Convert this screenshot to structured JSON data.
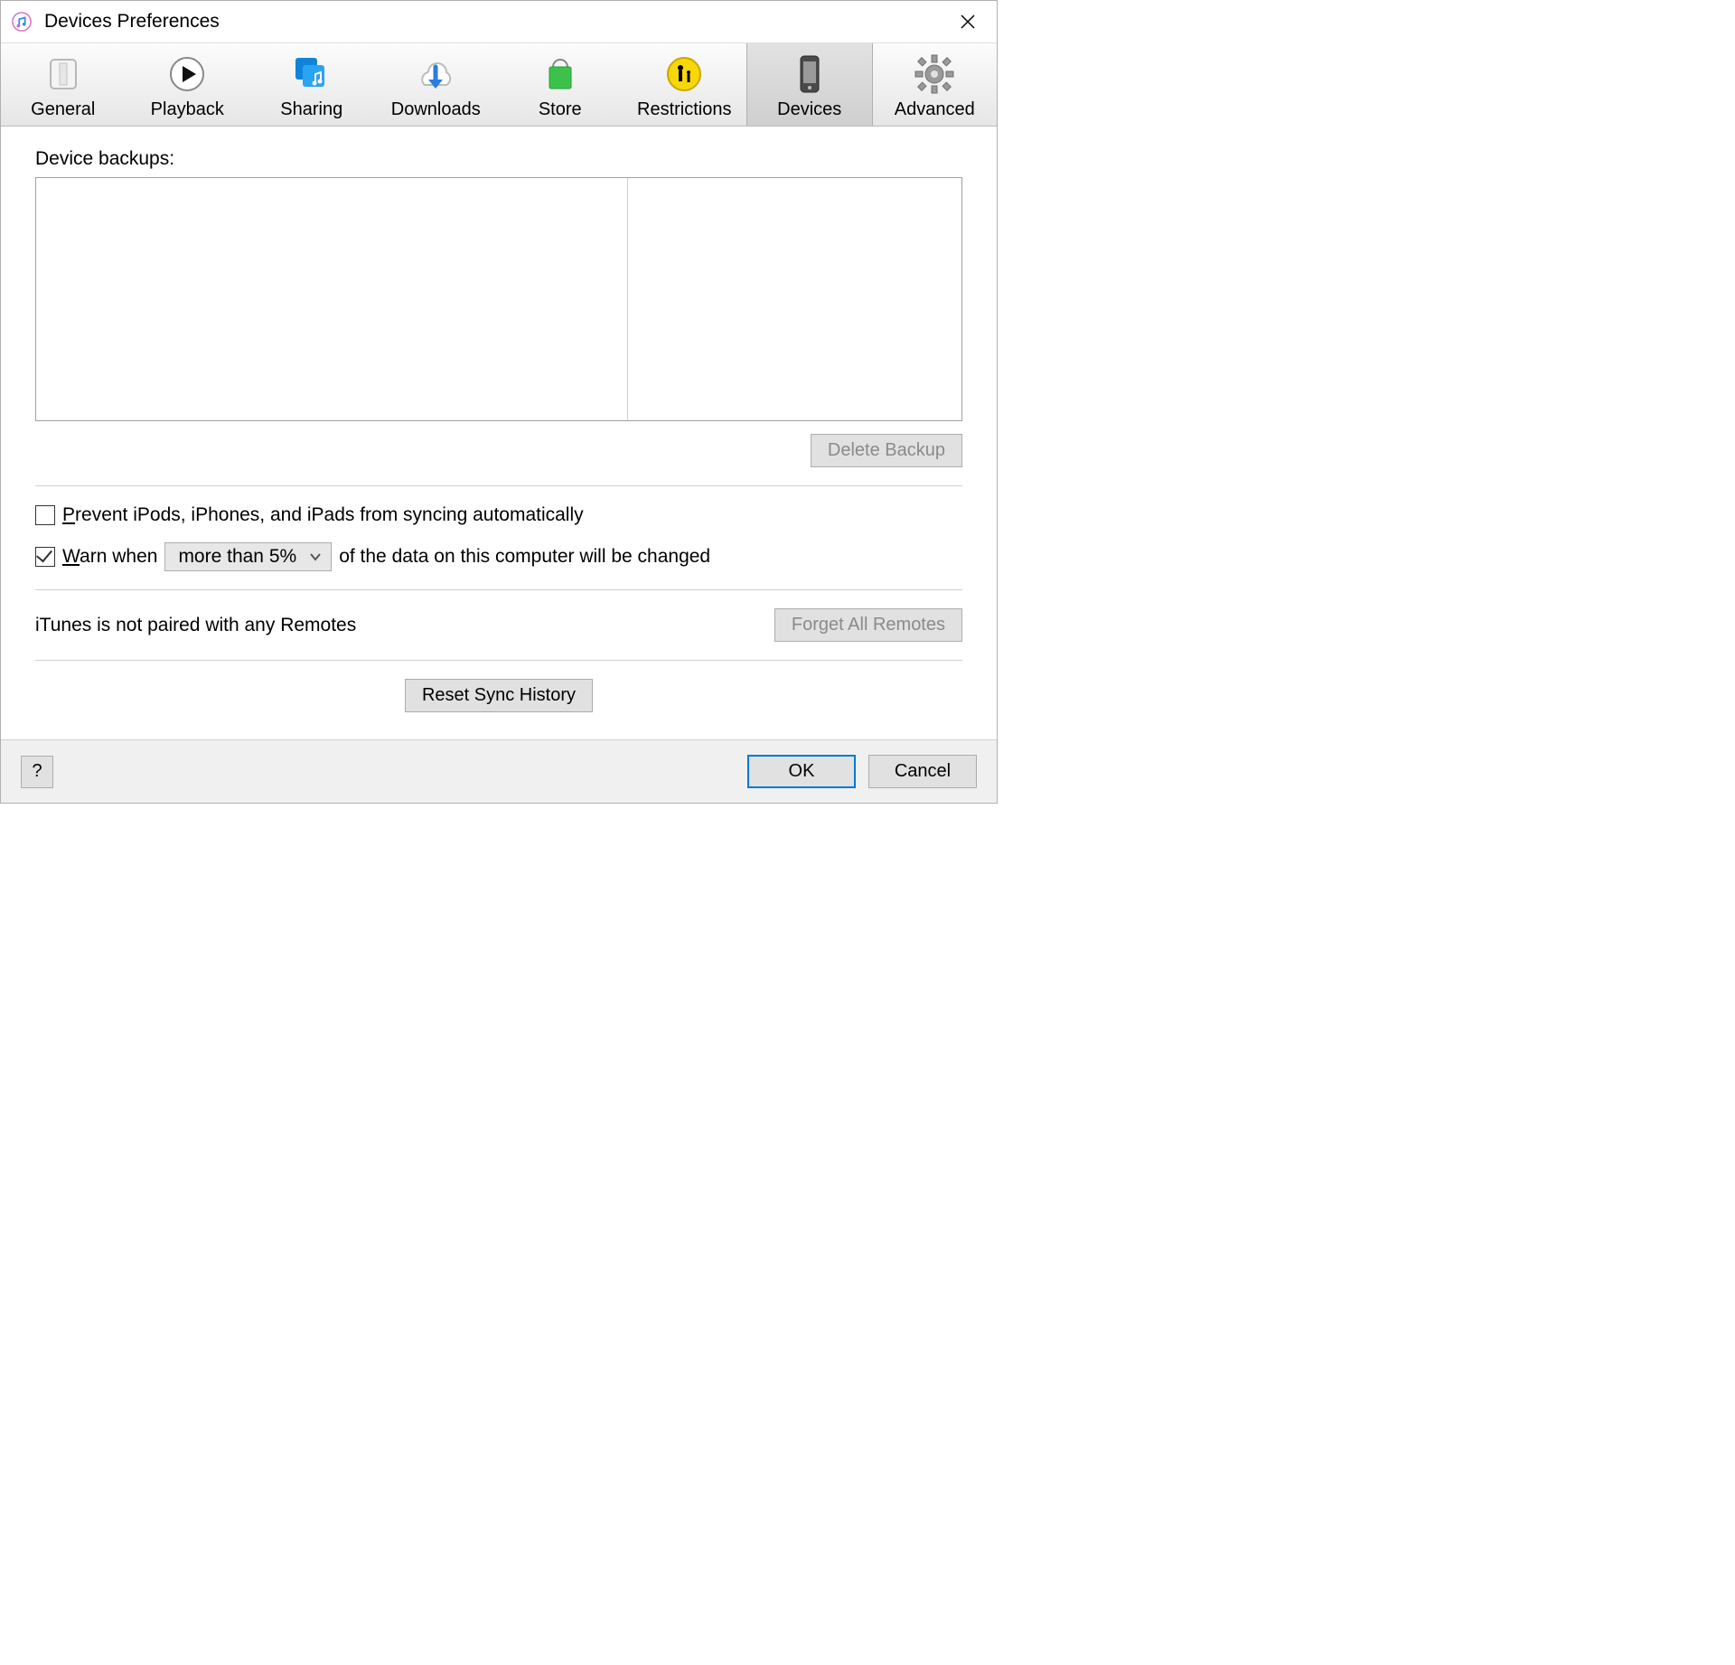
{
  "window": {
    "title": "Devices Preferences"
  },
  "toolbar": {
    "items": [
      {
        "label": "General"
      },
      {
        "label": "Playback"
      },
      {
        "label": "Sharing"
      },
      {
        "label": "Downloads"
      },
      {
        "label": "Store"
      },
      {
        "label": "Restrictions"
      },
      {
        "label": "Devices"
      },
      {
        "label": "Advanced"
      }
    ],
    "active_index": 6
  },
  "devices": {
    "backups_label": "Device backups:",
    "delete_backup_label": "Delete Backup",
    "prevent_sync_label": "Prevent iPods, iPhones, and iPads from syncing automatically",
    "prevent_sync_checked": false,
    "warn_checked": true,
    "warn_prefix": "Warn when",
    "warn_select_value": "more than 5%",
    "warn_suffix": "of the data on this computer will be changed",
    "remotes_status": "iTunes is not paired with any Remotes",
    "forget_remotes_label": "Forget All Remotes",
    "reset_sync_label": "Reset Sync History"
  },
  "footer": {
    "help_label": "?",
    "ok_label": "OK",
    "cancel_label": "Cancel"
  }
}
